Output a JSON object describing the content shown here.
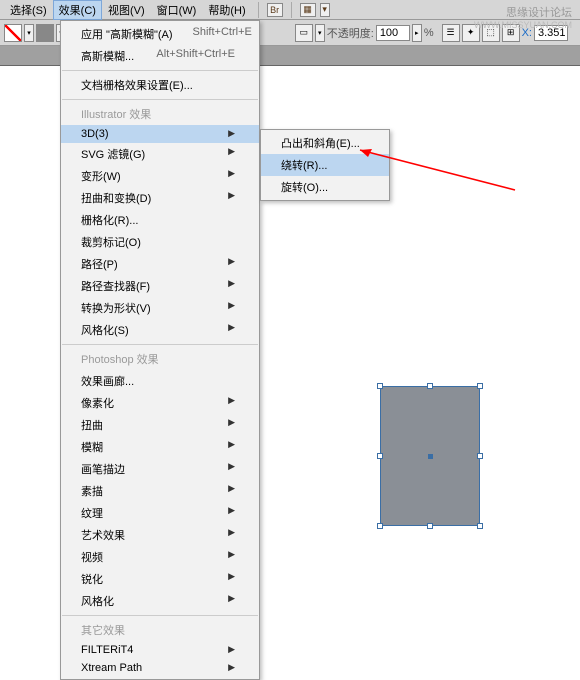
{
  "watermark": {
    "title": "思缘设计论坛",
    "url": "WWW.MISSYUAN.COM"
  },
  "menubar": {
    "select": "选择(S)",
    "effect": "效果(C)",
    "view": "视图(V)",
    "window": "窗口(W)",
    "help": "帮助(H)",
    "br": "Br",
    "grid": "▦"
  },
  "effect_menu": {
    "apply": "应用 \"高斯模糊\"(A)",
    "apply_sc": "Shift+Ctrl+E",
    "last": "高斯模糊...",
    "last_sc": "Alt+Shift+Ctrl+E",
    "doc_raster": "文档栅格效果设置(E)...",
    "hdr_ill": "Illustrator 效果",
    "i3d": "3D(3)",
    "svg": "SVG 滤镜(G)",
    "warp": "变形(W)",
    "distort": "扭曲和变换(D)",
    "rasterize": "栅格化(R)...",
    "crop": "裁剪标记(O)",
    "path": "路径(P)",
    "pathfinder": "路径查找器(F)",
    "convert": "转换为形状(V)",
    "stylize_i": "风格化(S)",
    "hdr_ps": "Photoshop 效果",
    "gallery": "效果画廊...",
    "pixelate": "像素化",
    "distort2": "扭曲",
    "blur": "模糊",
    "brush": "画笔描边",
    "sketch": "素描",
    "texture": "纹理",
    "artistic": "艺术效果",
    "video": "视频",
    "sharpen": "锐化",
    "stylize_p": "风格化",
    "hdr_other": "其它效果",
    "filterit": "FILTERiT4",
    "xtream": "Xtream Path"
  },
  "submenu": {
    "extrude": "凸出和斜角(E)...",
    "revolve": "绕转(R)...",
    "rotate": "旋转(O)..."
  },
  "toolbar": {
    "opacity_label": "不透明度:",
    "opacity_val": "100",
    "x_label": "X:",
    "x_val": "3.351"
  }
}
